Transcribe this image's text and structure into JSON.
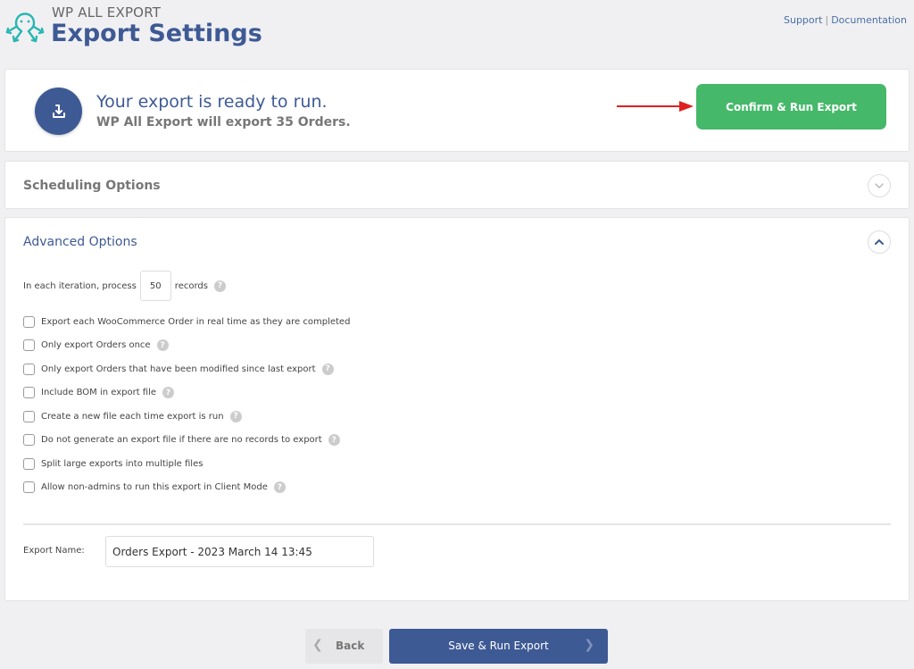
{
  "header": {
    "brand": "WP ALL EXPORT",
    "title": "Export Settings",
    "links": {
      "support": "Support",
      "separator": "|",
      "documentation": "Documentation"
    }
  },
  "ready_panel": {
    "heading": "Your export is ready to run.",
    "subheading": "WP All Export will export 35 Orders.",
    "confirm_button": "Confirm & Run Export",
    "icon": "download-icon",
    "accent": "#46b86a"
  },
  "scheduling": {
    "title": "Scheduling Options",
    "expanded": false
  },
  "advanced": {
    "title": "Advanced Options",
    "expanded": true,
    "iteration": {
      "prefix": "In each iteration, process",
      "value": "50",
      "suffix": "records"
    },
    "options": [
      {
        "label": "Export each WooCommerce Order in real time as they are completed",
        "checked": false,
        "help": false
      },
      {
        "label": "Only export Orders once",
        "checked": false,
        "help": true
      },
      {
        "label": "Only export Orders that have been modified since last export",
        "checked": false,
        "help": true
      },
      {
        "label": "Include BOM in export file",
        "checked": false,
        "help": true
      },
      {
        "label": "Create a new file each time export is run",
        "checked": false,
        "help": true
      },
      {
        "label": "Do not generate an export file if there are no records to export",
        "checked": false,
        "help": true
      },
      {
        "label": "Split large exports into multiple files",
        "checked": false,
        "help": false
      },
      {
        "label": "Allow non-admins to run this export in Client Mode",
        "checked": false,
        "help": true
      }
    ],
    "export_name": {
      "label": "Export Name:",
      "value": "Orders Export - 2023 March 14 13:45"
    }
  },
  "footer": {
    "back": "Back",
    "save": "Save & Run Export"
  },
  "colors": {
    "primary": "#3e5a94",
    "success": "#46b86a",
    "logo": "#2ab6b0",
    "arrow": "#e02020"
  }
}
